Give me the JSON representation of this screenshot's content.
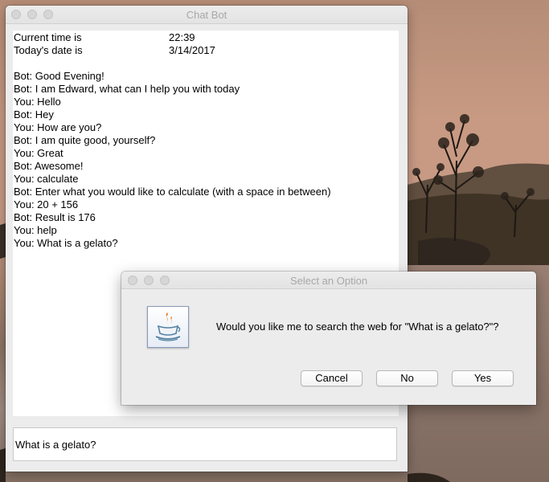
{
  "chat_window": {
    "title": "Chat Bot",
    "info": [
      {
        "label": "Current time is",
        "value": "22:39"
      },
      {
        "label": "Today's date is",
        "value": "3/14/2017"
      }
    ],
    "messages": [
      "Bot: Good Evening!",
      "Bot: I am Edward, what can I help you with today",
      "You: Hello",
      "Bot: Hey",
      "You: How are you?",
      "Bot: I am quite good, yourself?",
      "You: Great",
      "Bot: Awesome!",
      "You: calculate",
      "Bot: Enter what you would like to calculate (with a space in between)",
      "You: 20 + 156",
      "Bot: Result is 176",
      "You: help",
      "You: What is a gelato?"
    ],
    "input_value": "What is a gelato?"
  },
  "dialog": {
    "title": "Select an Option",
    "message": "Would you like me to search the web for \"What is a gelato?\"?",
    "icon": "java-coffee-cup-icon",
    "buttons": {
      "cancel": "Cancel",
      "no": "No",
      "yes": "Yes"
    }
  },
  "colors": {
    "window_bg": "#ececec",
    "title_text": "#a8a8a8",
    "traffic_light_inactive": "#d6d6d6"
  }
}
